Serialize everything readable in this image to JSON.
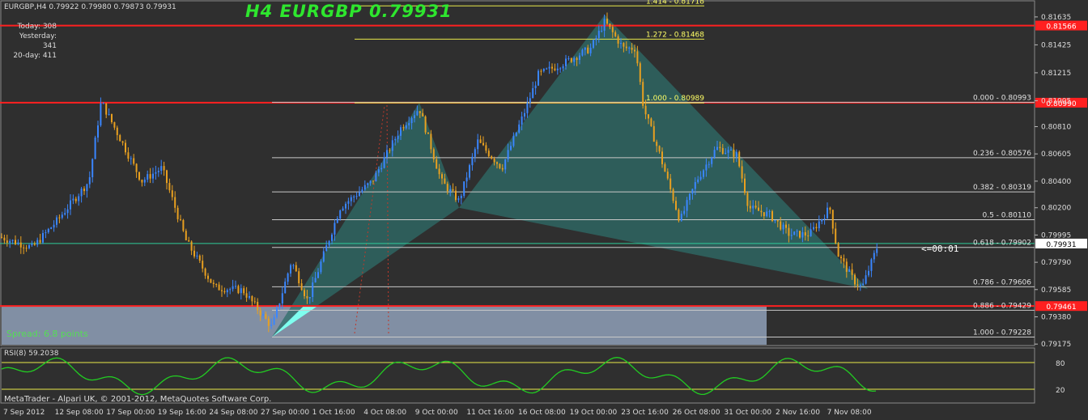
{
  "header": {
    "symbol_line": "EURGBP,H4  0.79922 0.79980 0.79873 0.79931",
    "big_title": "H4  EURGBP  0.79931"
  },
  "stats": {
    "today": "Today: 308",
    "yesterday": "Yesterday: 341",
    "twenty_day": "20-day: 411"
  },
  "spread_label": "Spread: 6.8 points",
  "countdown": "<=00:01",
  "rsi_label": "RSI(8) 59.2038",
  "copyright": "MetaTrader - Alpari UK, © 2001-2012, MetaQuotes Software Corp.",
  "colors": {
    "background": "#2f2f2f",
    "bull_candle": "#3a86ff",
    "bear_candle": "#e8a020",
    "fib_line": "#c8c8c8",
    "fib_ext_line": "#e8e84a",
    "red_level": "#ff2020",
    "price_line": "#2ecc9a",
    "harmonic_fill": "#2f6e6a",
    "rsi_line": "#22cc22",
    "title_green": "#2ee62e"
  },
  "chart_data": {
    "type": "candlestick",
    "symbol": "EURGBP",
    "timeframe": "H4",
    "ylim": [
      0.7917,
      0.8175
    ],
    "price_axis_ticks": [
      "0.81635",
      "0.81425",
      "0.81215",
      "0.81005",
      "0.80810",
      "0.80605",
      "0.80400",
      "0.80200",
      "0.79995",
      "0.79790",
      "0.79585",
      "0.79380",
      "0.79175"
    ],
    "time_axis_labels": [
      "7 Sep 2012",
      "12 Sep 08:00",
      "17 Sep 00:00",
      "19 Sep 16:00",
      "24 Sep 08:00",
      "27 Sep 00:00",
      "1 Oct 16:00",
      "4 Oct 08:00",
      "9 Oct 00:00",
      "11 Oct 16:00",
      "16 Oct 08:00",
      "19 Oct 00:00",
      "23 Oct 16:00",
      "26 Oct 08:00",
      "31 Oct 00:00",
      "2 Nov 16:00",
      "7 Nov 08:00"
    ],
    "current_price": "0.79931",
    "red_levels": [
      {
        "price": 0.8157,
        "label": "0.81566"
      },
      {
        "price": 0.8099,
        "label": "0.80990"
      },
      {
        "price": 0.79461,
        "label": "0.79461"
      }
    ],
    "fib_retracements": [
      {
        "ratio": "0.000",
        "price": 0.80993,
        "label": "0.000 - 0.80993"
      },
      {
        "ratio": "0.236",
        "price": 0.80576,
        "label": "0.236 - 0.80576"
      },
      {
        "ratio": "0.382",
        "price": 0.80319,
        "label": "0.382 - 0.80319"
      },
      {
        "ratio": "0.5",
        "price": 0.8011,
        "label": "0.5 - 0.80110"
      },
      {
        "ratio": "0.618",
        "price": 0.79902,
        "label": "0.618 - 0.79902"
      },
      {
        "ratio": "0.786",
        "price": 0.79606,
        "label": "0.786 - 0.79606"
      },
      {
        "ratio": "0.886",
        "price": 0.79429,
        "label": "0.886 - 0.79429"
      },
      {
        "ratio": "1.000",
        "price": 0.79228,
        "label": "1.000 - 0.79228"
      }
    ],
    "fib_extensions": [
      {
        "ratio": "1.414",
        "price": 0.81718,
        "label": "1.414 - 0.81718"
      },
      {
        "ratio": "1.272",
        "price": 0.81468,
        "label": "1.272 - 0.81468"
      },
      {
        "ratio": "1.000",
        "price": 0.80989,
        "label": "1.000 - 0.80989"
      }
    ],
    "harmonic_points": [
      {
        "time": "27 Sep 00:00",
        "price": 0.79228
      },
      {
        "time": "9 Oct 00:00",
        "price": 0.8099
      },
      {
        "time": "11 Oct 16:00",
        "price": 0.802
      },
      {
        "time": "19 Oct 00:00",
        "price": 0.8165
      },
      {
        "time": "7 Nov 08:00",
        "price": 0.7959
      }
    ],
    "rsi": {
      "period": 8,
      "value": 59.2038,
      "levels": [
        80,
        20
      ],
      "ylim": [
        0,
        100
      ],
      "axis_labels": [
        "80",
        "20"
      ]
    }
  }
}
